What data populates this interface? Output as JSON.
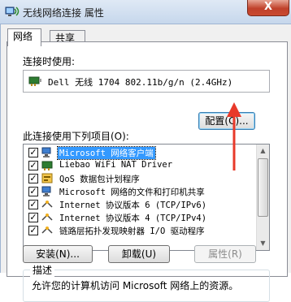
{
  "window": {
    "title": "无线网络连接 属性",
    "close_label": "X"
  },
  "tabs": [
    {
      "label": "网络"
    },
    {
      "label": "共享"
    }
  ],
  "connect_using": {
    "label": "连接时使用:",
    "adapter": "Dell 无线 1704 802.11b/g/n (2.4GHz)",
    "configure_button": "配置(C)..."
  },
  "items_section": {
    "label": "此连接使用下列项目(O):",
    "items": [
      {
        "label": "Microsoft 网络客户端",
        "checked": true,
        "icon": "network-client-icon"
      },
      {
        "label": "Liebao WiFi NAT Driver",
        "checked": true,
        "icon": "network-driver-icon"
      },
      {
        "label": "QoS 数据包计划程序",
        "checked": true,
        "icon": "qos-scheduler-icon"
      },
      {
        "label": "Microsoft 网络的文件和打印机共享",
        "checked": true,
        "icon": "file-printer-sharing-icon"
      },
      {
        "label": "Internet 协议版本 6 (TCP/IPv6)",
        "checked": true,
        "icon": "protocol-icon"
      },
      {
        "label": "Internet 协议版本 4 (TCP/IPv4)",
        "checked": true,
        "icon": "protocol-icon"
      },
      {
        "label": "链路层拓扑发现映射器 I/O 驱动程序",
        "checked": true,
        "icon": "protocol-icon"
      }
    ]
  },
  "buttons": {
    "install": "安装(N)...",
    "uninstall": "卸载(U)",
    "properties": "属性(R)"
  },
  "description": {
    "title": "描述",
    "text": "允许您的计算机访问 Microsoft 网络上的资源。"
  },
  "colors": {
    "annotation_arrow": "#e8392a",
    "selection": "#3399ff"
  }
}
